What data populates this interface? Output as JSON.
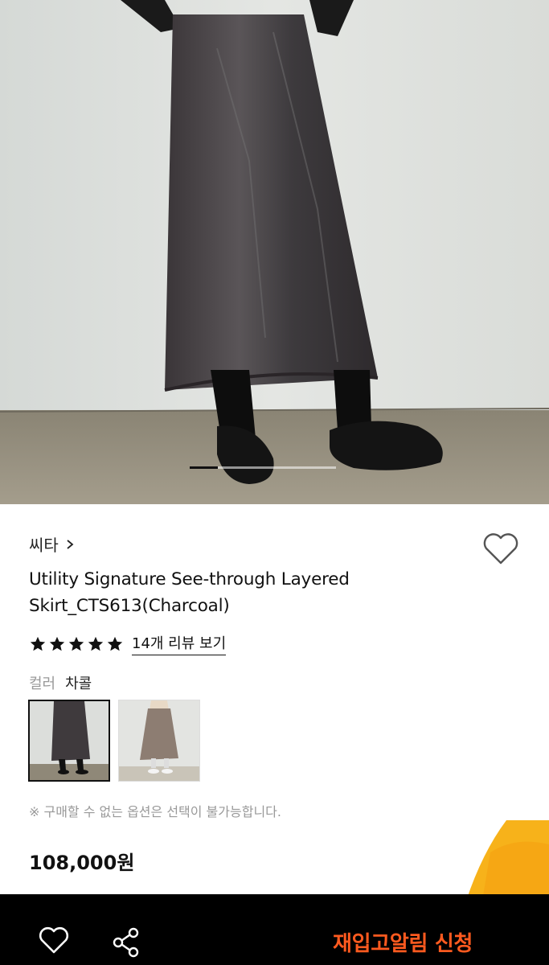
{
  "brand": {
    "name": "씨타"
  },
  "product": {
    "title": "Utility Signature See-through Layered Skirt_CTS613(Charcoal)",
    "rating": 5,
    "review_link": "14개 리뷰 보기",
    "color_label": "컬러",
    "color_value": "차콜",
    "swatches": [
      {
        "name": "charcoal",
        "selected": true
      },
      {
        "name": "beige",
        "selected": false
      }
    ],
    "notice": "※ 구매할 수 없는 옵션은 선택이 불가능합니다.",
    "price": "108,000원"
  },
  "bottom_bar": {
    "cta": "재입고알림 신청"
  },
  "colors": {
    "accent": "#ff5a1f",
    "bar": "#000000",
    "star": "#111111"
  },
  "icons": [
    "chevron-right-icon",
    "heart-outline-icon",
    "star-icon",
    "share-icon"
  ]
}
